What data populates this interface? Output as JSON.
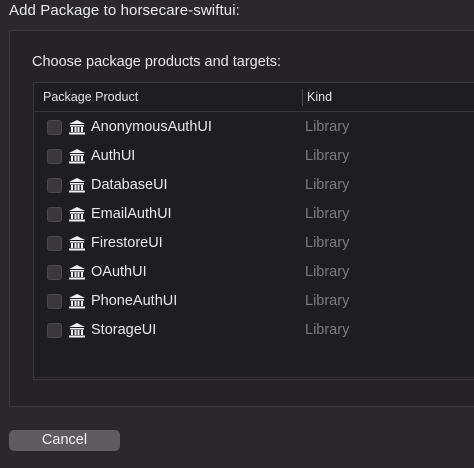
{
  "sheet": {
    "title": "Add Package to horsecare-swiftui:"
  },
  "panel": {
    "subtitle": "Choose package products and targets:"
  },
  "table": {
    "columns": [
      "Package Product",
      "Kind"
    ],
    "rows": [
      {
        "product": "AnonymousAuthUI",
        "kind": "Library",
        "checked": false
      },
      {
        "product": "AuthUI",
        "kind": "Library",
        "checked": false
      },
      {
        "product": "DatabaseUI",
        "kind": "Library",
        "checked": false
      },
      {
        "product": "EmailAuthUI",
        "kind": "Library",
        "checked": false
      },
      {
        "product": "FirestoreUI",
        "kind": "Library",
        "checked": false
      },
      {
        "product": "OAuthUI",
        "kind": "Library",
        "checked": false
      },
      {
        "product": "PhoneAuthUI",
        "kind": "Library",
        "checked": false
      },
      {
        "product": "StorageUI",
        "kind": "Library",
        "checked": false
      }
    ],
    "row_icon": "library-icon"
  },
  "footer": {
    "cancel_label": "Cancel"
  },
  "colors": {
    "background": "#2a282d",
    "table_background": "#1e1d21",
    "kind_text": "#7c7a80",
    "button": "#5e5c61"
  }
}
